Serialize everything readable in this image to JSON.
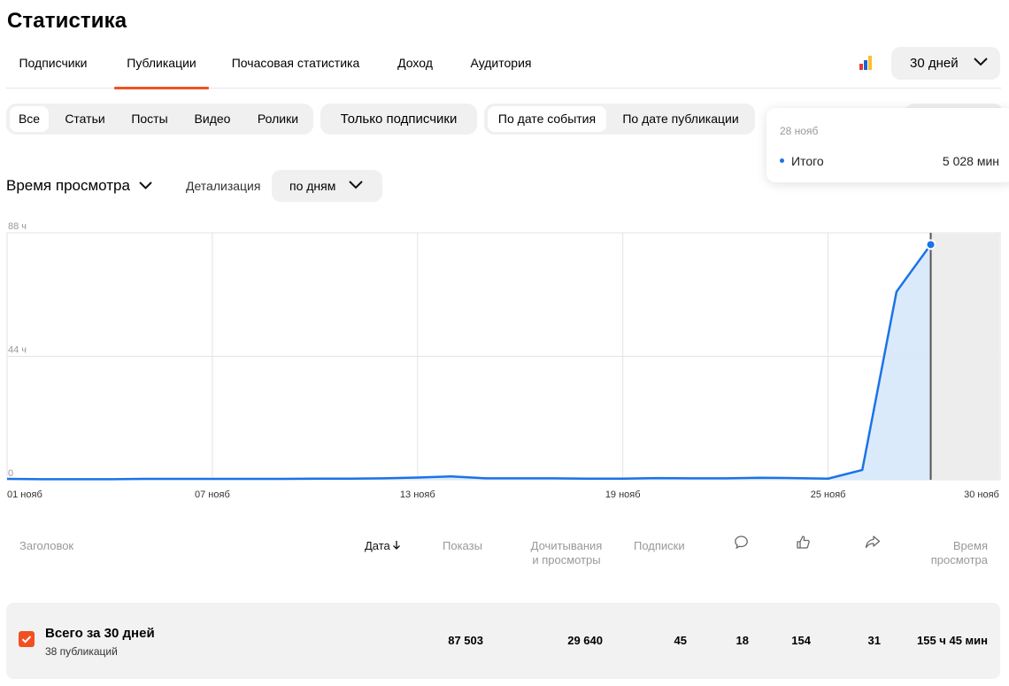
{
  "page": {
    "title": "Статистика"
  },
  "tabs": [
    {
      "label": "Подписчики"
    },
    {
      "label": "Публикации",
      "active": true
    },
    {
      "label": "Почасовая статистика"
    },
    {
      "label": "Доход"
    },
    {
      "label": "Аудитория"
    }
  ],
  "period": {
    "label": "30 дней",
    "icon": "bar-chart-icon"
  },
  "filters": {
    "types": [
      "Все",
      "Статьи",
      "Посты",
      "Видео",
      "Ролики"
    ],
    "types_active": "Все",
    "subscribers_only": "Только подписчики",
    "date_modes": [
      "По дате события",
      "По дате публикации"
    ],
    "date_mode_active": "По дате события"
  },
  "tooltip": {
    "date": "28 нояб",
    "series": "Итого",
    "value": "5 028 мин"
  },
  "metric": {
    "label": "Время просмотра",
    "detail_label": "Детализация",
    "detail_value": "по дням"
  },
  "colors": {
    "accent": "#f25022",
    "line": "#1a73e8",
    "area": "#d6e8fb",
    "grid": "#e3e3e3"
  },
  "chart_data": {
    "type": "area",
    "ytick_labels": [
      "0",
      "44 ч",
      "88 ч"
    ],
    "yticks_hours": [
      0,
      44,
      88
    ],
    "ylim": [
      0,
      88
    ],
    "xtick_labels": [
      "01 нояб",
      "07 нояб",
      "13 нояб",
      "19 нояб",
      "25 нояб",
      "30 нояб"
    ],
    "x": [
      "01 нояб",
      "02 нояб",
      "03 нояб",
      "04 нояб",
      "05 нояб",
      "06 нояб",
      "07 нояб",
      "08 нояб",
      "09 нояб",
      "10 нояб",
      "11 нояб",
      "12 нояб",
      "13 нояб",
      "14 нояб",
      "15 нояб",
      "16 нояб",
      "17 нояб",
      "18 нояб",
      "19 нояб",
      "20 нояб",
      "21 нояб",
      "22 нояб",
      "23 нояб",
      "24 нояб",
      "25 нояб",
      "26 нояб",
      "27 нояб",
      "28 нояб"
    ],
    "series": [
      {
        "name": "Итого",
        "values_hours": [
          0.3,
          0.2,
          0.2,
          0.2,
          0.3,
          0.3,
          0.3,
          0.3,
          0.3,
          0.4,
          0.4,
          0.5,
          0.8,
          1.2,
          0.5,
          0.5,
          0.5,
          0.4,
          0.4,
          0.6,
          0.5,
          0.5,
          0.7,
          0.6,
          0.4,
          3.5,
          67,
          83.8
        ]
      }
    ],
    "selected_index": 27,
    "grid": true
  },
  "table": {
    "headers": {
      "title": "Заголовок",
      "date": "Дата",
      "shows": "Показы",
      "reads_line1": "Дочитывания",
      "reads_line2": "и просмотры",
      "subs": "Подписки",
      "time_line1": "Время",
      "time_line2": "просмотра"
    },
    "header_icons": [
      "comment-icon",
      "like-icon",
      "share-icon"
    ],
    "total": {
      "title": "Всего за 30 дней",
      "subtitle": "38 публикаций",
      "shows": "87 503",
      "reads": "29 640",
      "subs": "45",
      "comments": "18",
      "likes": "154",
      "shares": "31",
      "time": "155 ч 45 мин"
    }
  }
}
